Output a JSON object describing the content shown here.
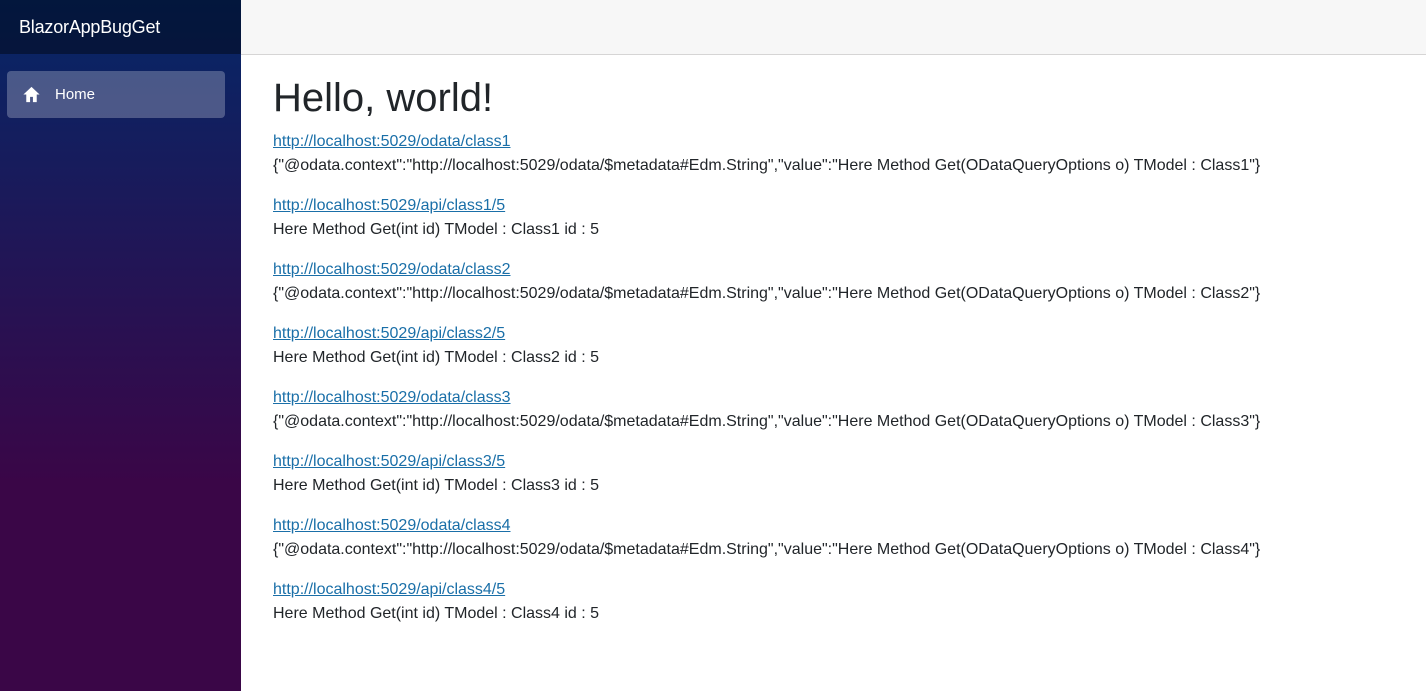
{
  "app": {
    "brand": "BlazorAppBugGet"
  },
  "nav": {
    "items": [
      {
        "label": "Home",
        "icon": "home-icon"
      }
    ]
  },
  "page": {
    "title": "Hello, world!",
    "entries": [
      {
        "url": "http://localhost:5029/odata/class1",
        "result": "{\"@odata.context\":\"http://localhost:5029/odata/$metadata#Edm.String\",\"value\":\"Here Method Get(ODataQueryOptions o) TModel : Class1\"}"
      },
      {
        "url": "http://localhost:5029/api/class1/5",
        "result": "Here Method Get(int id) TModel : Class1 id : 5"
      },
      {
        "url": "http://localhost:5029/odata/class2",
        "result": "{\"@odata.context\":\"http://localhost:5029/odata/$metadata#Edm.String\",\"value\":\"Here Method Get(ODataQueryOptions o) TModel : Class2\"}"
      },
      {
        "url": "http://localhost:5029/api/class2/5",
        "result": "Here Method Get(int id) TModel : Class2 id : 5"
      },
      {
        "url": "http://localhost:5029/odata/class3",
        "result": "{\"@odata.context\":\"http://localhost:5029/odata/$metadata#Edm.String\",\"value\":\"Here Method Get(ODataQueryOptions o) TModel : Class3\"}"
      },
      {
        "url": "http://localhost:5029/api/class3/5",
        "result": "Here Method Get(int id) TModel : Class3 id : 5"
      },
      {
        "url": "http://localhost:5029/odata/class4",
        "result": "{\"@odata.context\":\"http://localhost:5029/odata/$metadata#Edm.String\",\"value\":\"Here Method Get(ODataQueryOptions o) TModel : Class4\"}"
      },
      {
        "url": "http://localhost:5029/api/class4/5",
        "result": "Here Method Get(int id) TModel : Class4 id : 5"
      }
    ]
  },
  "colors": {
    "sidebar_top": "#052767",
    "sidebar_bottom": "#3a0647",
    "link": "#1a6fa8",
    "text": "#212529",
    "top_row": "#f7f7f7"
  }
}
